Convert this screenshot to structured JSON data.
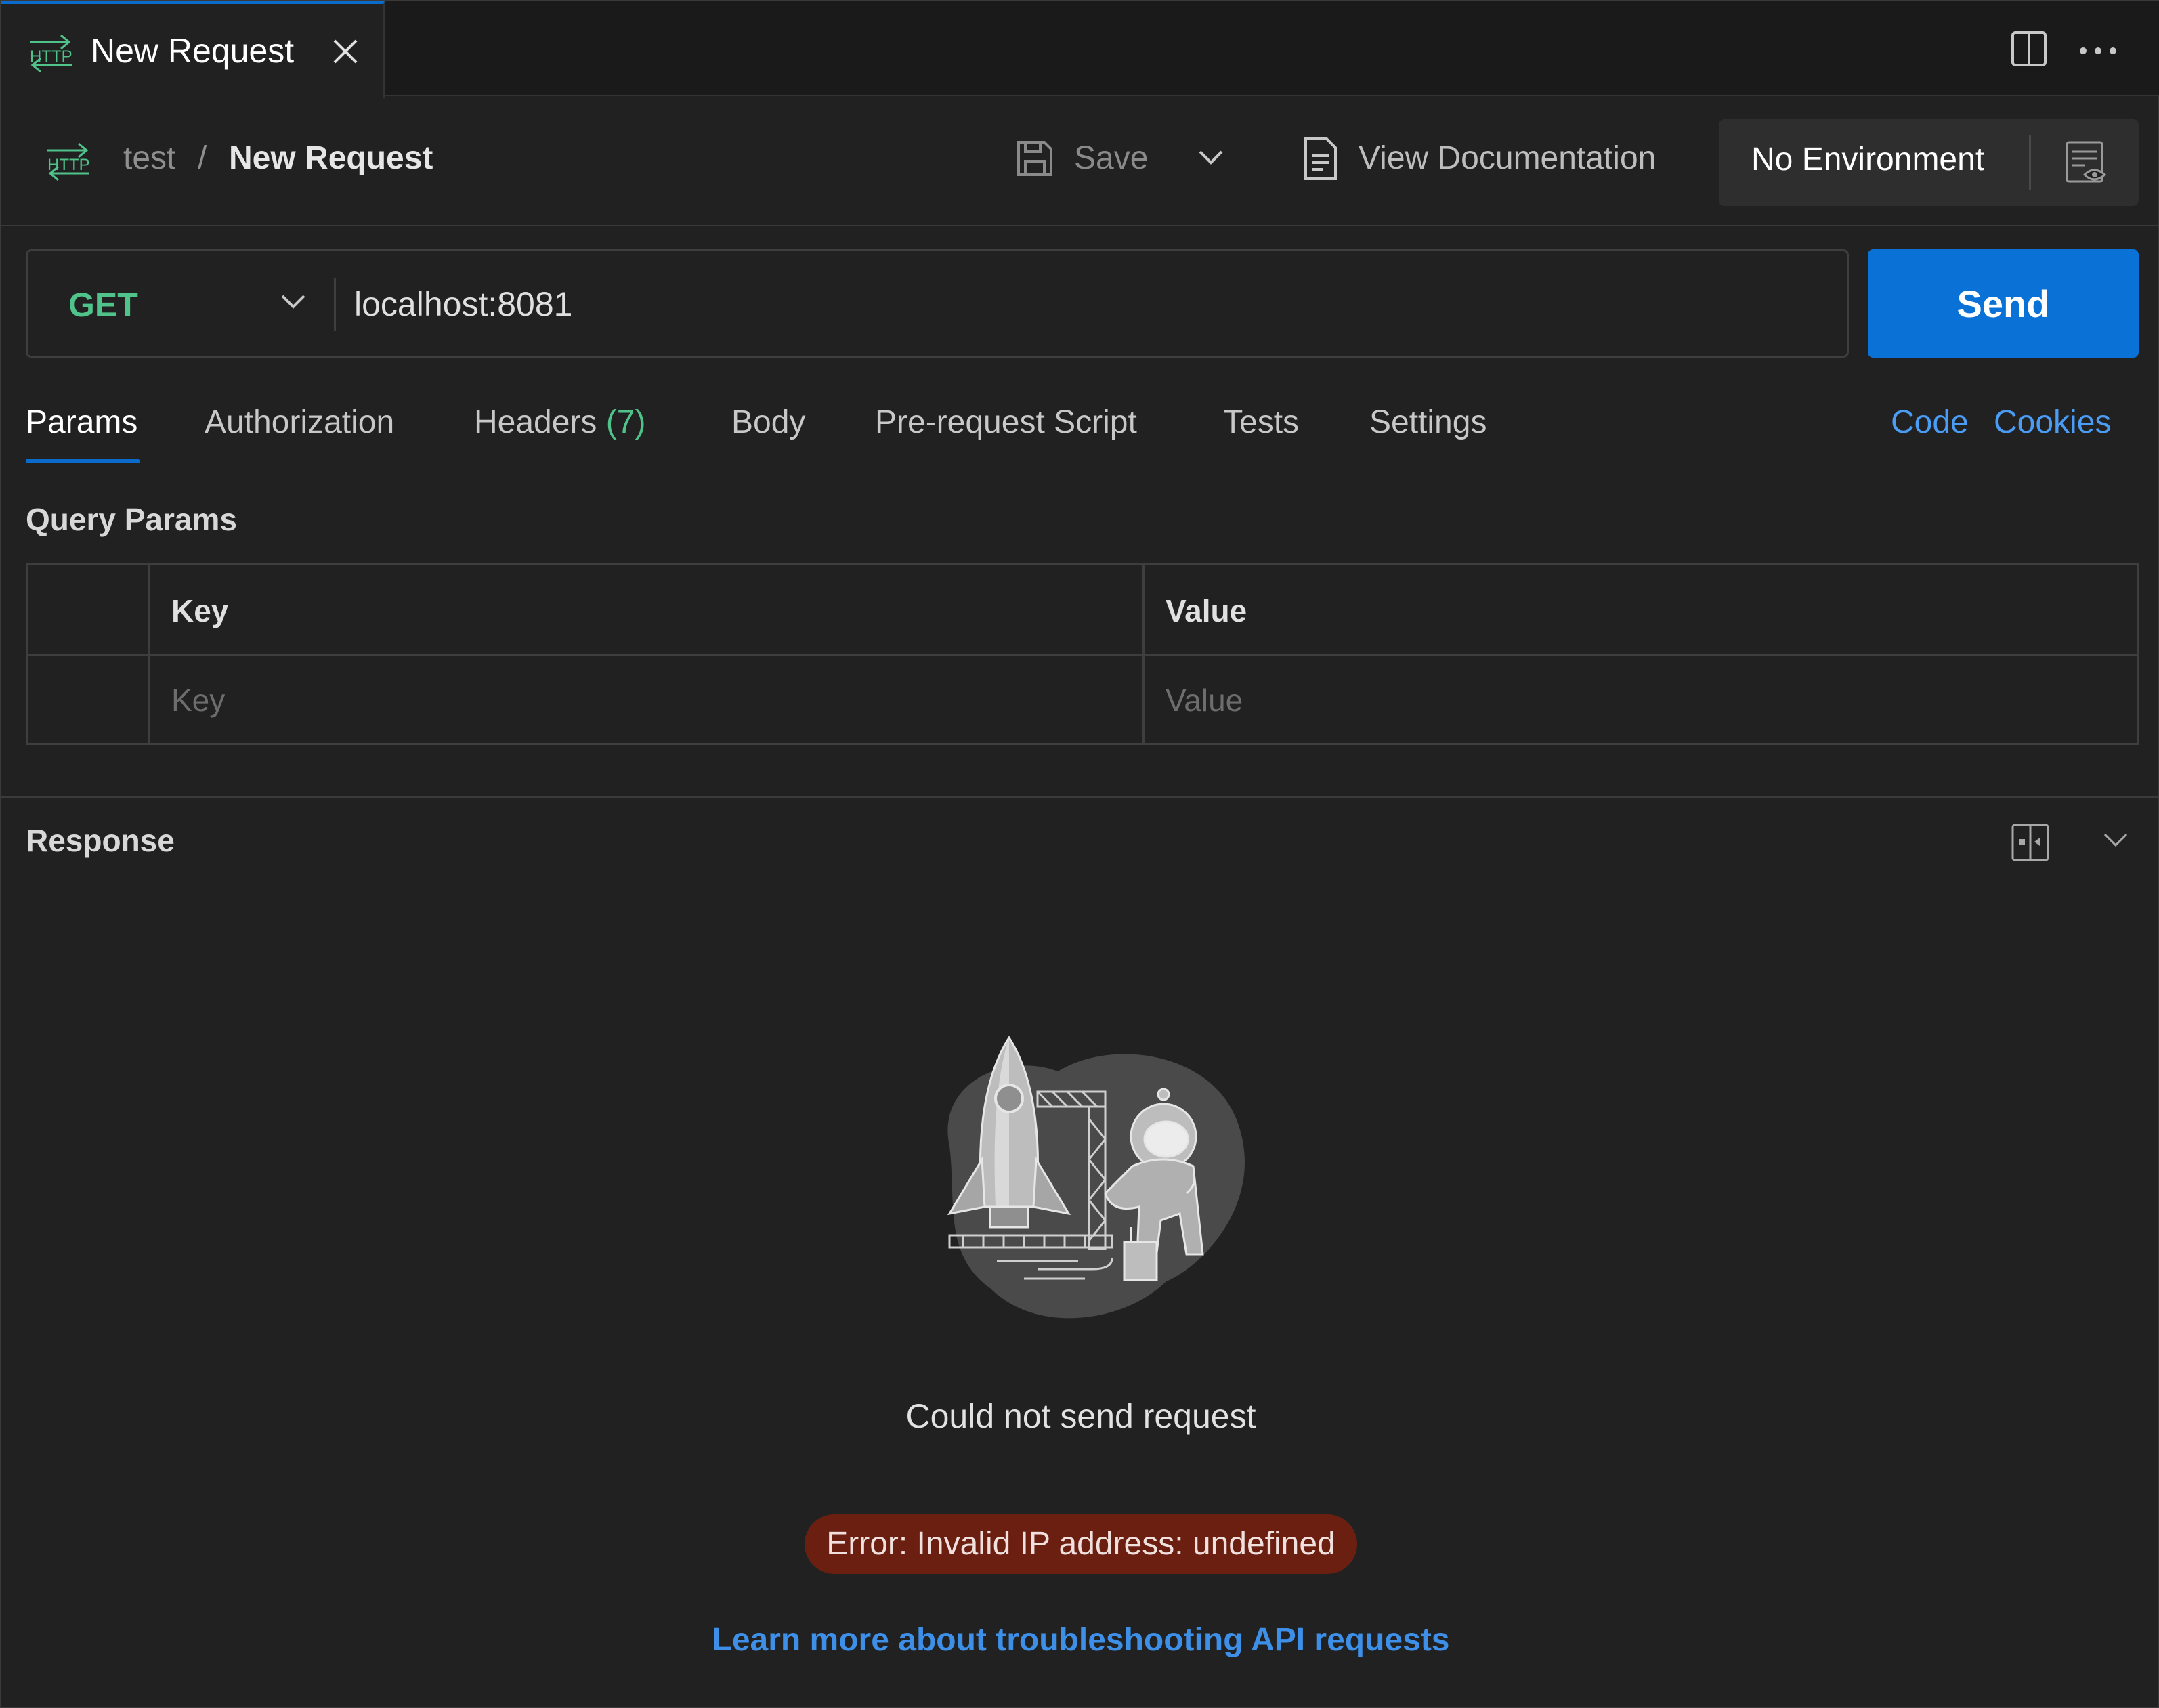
{
  "tab": {
    "title": "New Request",
    "icon": "http-icon"
  },
  "breadcrumb": {
    "collection": "test",
    "separator": "/",
    "request": "New Request"
  },
  "toolbar": {
    "save_label": "Save",
    "docs_label": "View Documentation"
  },
  "environment": {
    "selected": "No Environment"
  },
  "request": {
    "method": "GET",
    "url": "localhost:8081",
    "send_label": "Send"
  },
  "request_tabs": {
    "params": "Params",
    "authorization": "Authorization",
    "headers": "Headers",
    "headers_count": "(7)",
    "body": "Body",
    "prerequest": "Pre-request Script",
    "tests": "Tests",
    "settings": "Settings",
    "code": "Code",
    "cookies": "Cookies"
  },
  "query_params": {
    "title": "Query Params",
    "columns": [
      "Key",
      "Value"
    ],
    "placeholders": [
      "Key",
      "Value"
    ]
  },
  "response": {
    "title": "Response",
    "message": "Could not send request",
    "error": "Error: Invalid IP address: undefined",
    "help_link": "Learn more about troubleshooting API requests"
  },
  "colors": {
    "accent": "#0b6bcb",
    "send_button": "#0a72d6",
    "method_get": "#4fc38a",
    "link": "#4b9cf5",
    "error_badge": "#6b1f10",
    "background": "#212121"
  }
}
